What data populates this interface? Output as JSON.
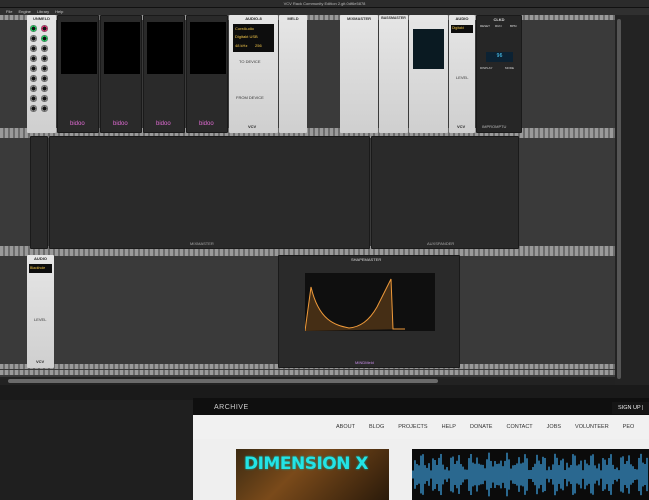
{
  "window": {
    "title": "VCV Rack Community Edition 2.git.0df6e5878"
  },
  "menu": [
    "File",
    "Engine",
    "Library",
    "Help"
  ],
  "modules": {
    "unmeld": "UNMELD",
    "bidoo": [
      "bidoo",
      "bidoo",
      "bidoo",
      "bidoo"
    ],
    "audio8": {
      "title": "AUDIO-8",
      "driver": "CoreAudio",
      "device": "Digitakt USB",
      "rate": "48 kHz",
      "block": "256",
      "to_device": "TO DEVICE",
      "from_device": "FROM DEVICE",
      "brand": "VCV"
    },
    "meld": "MELD",
    "mixmaster": "MIXMASTER",
    "bassmaster": "BASSMASTER",
    "audio2": {
      "title": "AUDIO",
      "device": "Digitakt",
      "level": "LEVEL",
      "brand": "VCV"
    },
    "clkd": {
      "title": "CLKD",
      "reset": "RESET",
      "run": "RUN",
      "bpm": "BPM",
      "bpm_value": "96",
      "display": "DISPLAY",
      "mode": "MODE"
    },
    "impromptu": "IMPROMPTU",
    "auxspander": "AUXSPANDER",
    "audio3": {
      "title": "AUDIO",
      "device": "Blackhole",
      "level": "LEVEL",
      "brand": "VCV"
    },
    "shapemaster": {
      "title": "SHAPEMASTER",
      "brand": "MINDMeld"
    }
  },
  "website": {
    "logo": "ARCHIVE",
    "signup": "SIGN UP |",
    "nav": [
      "ABOUT",
      "BLOG",
      "PROJECTS",
      "HELP",
      "DONATE",
      "CONTACT",
      "JOBS",
      "VOLUNTEER",
      "PEO"
    ],
    "banner": "DIMENSION X"
  },
  "colors": {
    "rack_bg": "#3a3a3a",
    "accent_lcd": "#4fd0ff",
    "banner_text": "#23e4e6",
    "mix_green": "#2bd36a"
  }
}
